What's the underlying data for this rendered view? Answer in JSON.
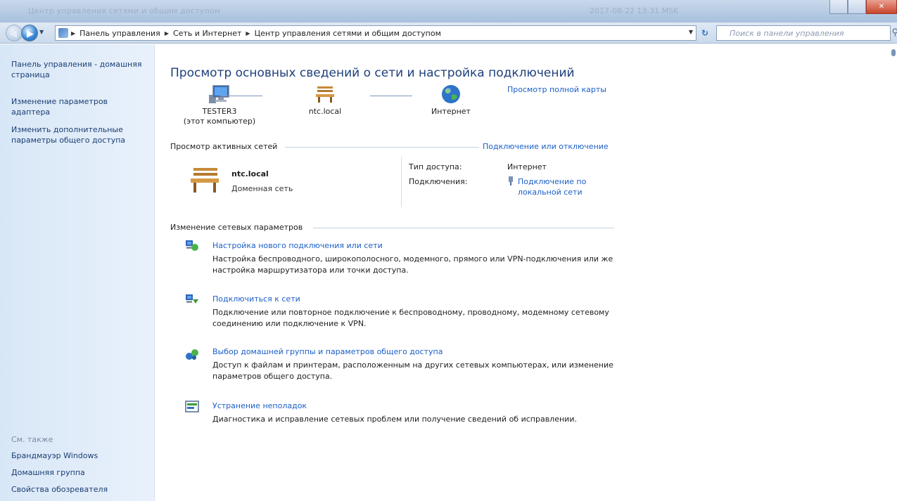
{
  "window": {
    "title": "Центр управления сетями и общим доступом",
    "stamp": "2017-08-22 13:31 MSK"
  },
  "address": {
    "crumbs": [
      "Панель управления",
      "Сеть и Интернет",
      "Центр управления сетями и общим доступом"
    ],
    "search_placeholder": "Поиск в панели управления"
  },
  "sidebar": {
    "items": [
      {
        "label": "Панель управления - домашняя страница"
      },
      {
        "label": "Изменение параметров адаптера"
      },
      {
        "label": "Изменить дополнительные параметры общего доступа"
      }
    ],
    "see_also": "См. также",
    "see_also_items": [
      {
        "label": "Брандмауэр Windows"
      },
      {
        "label": "Домашняя группа"
      },
      {
        "label": "Свойства обозревателя"
      }
    ]
  },
  "main": {
    "title": "Просмотр основных сведений о сети и настройка подключений",
    "map_link": "Просмотр полной карты",
    "map_nodes": [
      {
        "label": "TESTER3",
        "sublabel": "(этот компьютер)",
        "icon": "computer-icon"
      },
      {
        "label": "ntc.local",
        "sublabel": "",
        "icon": "bench-icon"
      },
      {
        "label": "Интернет",
        "sublabel": "",
        "icon": "globe-icon"
      }
    ],
    "active_networks_heading": "Просмотр активных сетей",
    "connect_link": "Подключение или отключение",
    "active_network": {
      "name": "ntc.local",
      "type": "Доменная сеть",
      "access_type_label": "Тип доступа:",
      "access_type_value": "Интернет",
      "connections_label": "Подключения:",
      "connection_link": "Подключение по локальной сети"
    },
    "settings_heading": "Изменение сетевых параметров",
    "tasks": [
      {
        "title": "Настройка нового подключения или сети",
        "desc": "Настройка беспроводного, широкополосного, модемного, прямого или VPN-подключения или же настройка маршрутизатора или точки доступа.",
        "icon": "new-connection-icon"
      },
      {
        "title": "Подключиться к сети",
        "desc": "Подключение или повторное подключение к беспроводному, проводному, модемному сетевому соединению или подключение к VPN.",
        "icon": "connect-network-icon"
      },
      {
        "title": "Выбор домашней группы и параметров общего доступа",
        "desc": "Доступ к файлам и принтерам, расположенным на других сетевых компьютерах, или изменение параметров общего доступа.",
        "icon": "homegroup-icon"
      },
      {
        "title": "Устранение неполадок",
        "desc": "Диагностика и исправление сетевых проблем или получение сведений об исправлении.",
        "icon": "troubleshoot-icon"
      }
    ]
  },
  "colors": {
    "link": "#1a5ec7",
    "title": "#1e3f7b",
    "sidebar_bg": "#dbe8f7"
  }
}
